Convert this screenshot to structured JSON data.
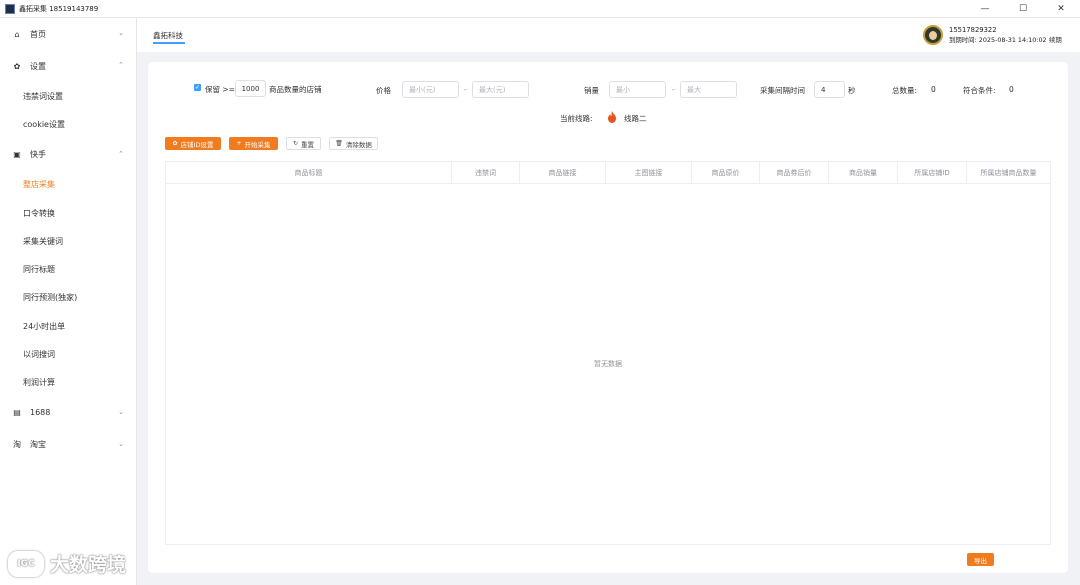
{
  "window": {
    "title": "鑫拓采集 18519143789",
    "minimize": "—",
    "maximize": "☐",
    "close": "✕"
  },
  "sidebar": {
    "groups": [
      {
        "icon": "home-icon",
        "glyph": "⌂",
        "label": "首页",
        "chev": "⌄"
      },
      {
        "icon": "gear-icon",
        "glyph": "✿",
        "label": "设置",
        "chev": "⌃"
      },
      {
        "icon": "kuaishou-icon",
        "glyph": "▣",
        "label": "快手",
        "chev": "⌃"
      },
      {
        "icon": "store-icon",
        "glyph": "▤",
        "label": "1688",
        "chev": "⌄"
      },
      {
        "icon": "taobao-icon",
        "glyph": "淘",
        "label": "淘宝",
        "chev": "⌄"
      }
    ],
    "settings_items": [
      "违禁词设置",
      "cookie设置"
    ],
    "kuaishou_items": [
      "整店采集",
      "口令转换",
      "采集关键词",
      "同行标题",
      "同行预测(独家)",
      "24小时出单",
      "以词搜词",
      "利润计算"
    ],
    "active_item": "整店采集"
  },
  "header": {
    "tab": "鑫拓科技",
    "user_phone": "15517829322",
    "expire": "到期时间: 2025-08-31 14:10:02",
    "renew": "续期"
  },
  "filters": {
    "keep_checked": true,
    "keep_label": "保留 >=",
    "keep_value": "1000",
    "keep_suffix": "商品数量的店铺",
    "price_label": "价格",
    "price_min_placeholder": "最小(元)",
    "price_max_placeholder": "最大(元)",
    "dash": "-",
    "sales_label": "销量",
    "sales_min_placeholder": "最小",
    "sales_max_placeholder": "最大",
    "interval_label": "采集间隔时间",
    "interval_value": "4",
    "interval_unit": "秒",
    "total_label": "总数量:",
    "total_value": "0",
    "match_label": "符合条件:",
    "match_value": "0",
    "line_label": "当前线路:",
    "line_value": "线路二"
  },
  "buttons": {
    "shop_id": "店铺ID设置",
    "start": "开始采集",
    "reset": "重置",
    "clear": "清除数据",
    "export": "导出"
  },
  "table": {
    "columns": [
      "商品标题",
      "违禁词",
      "商品链接",
      "主图链接",
      "商品原价",
      "商品券后价",
      "商品销量",
      "所属店铺ID",
      "所属店铺商品数量"
    ],
    "empty_text": "暂无数据"
  },
  "watermark": {
    "mark": "IGC",
    "text": "大数跨境"
  },
  "colors": {
    "accent": "#f07c1f",
    "primary": "#409eff"
  }
}
